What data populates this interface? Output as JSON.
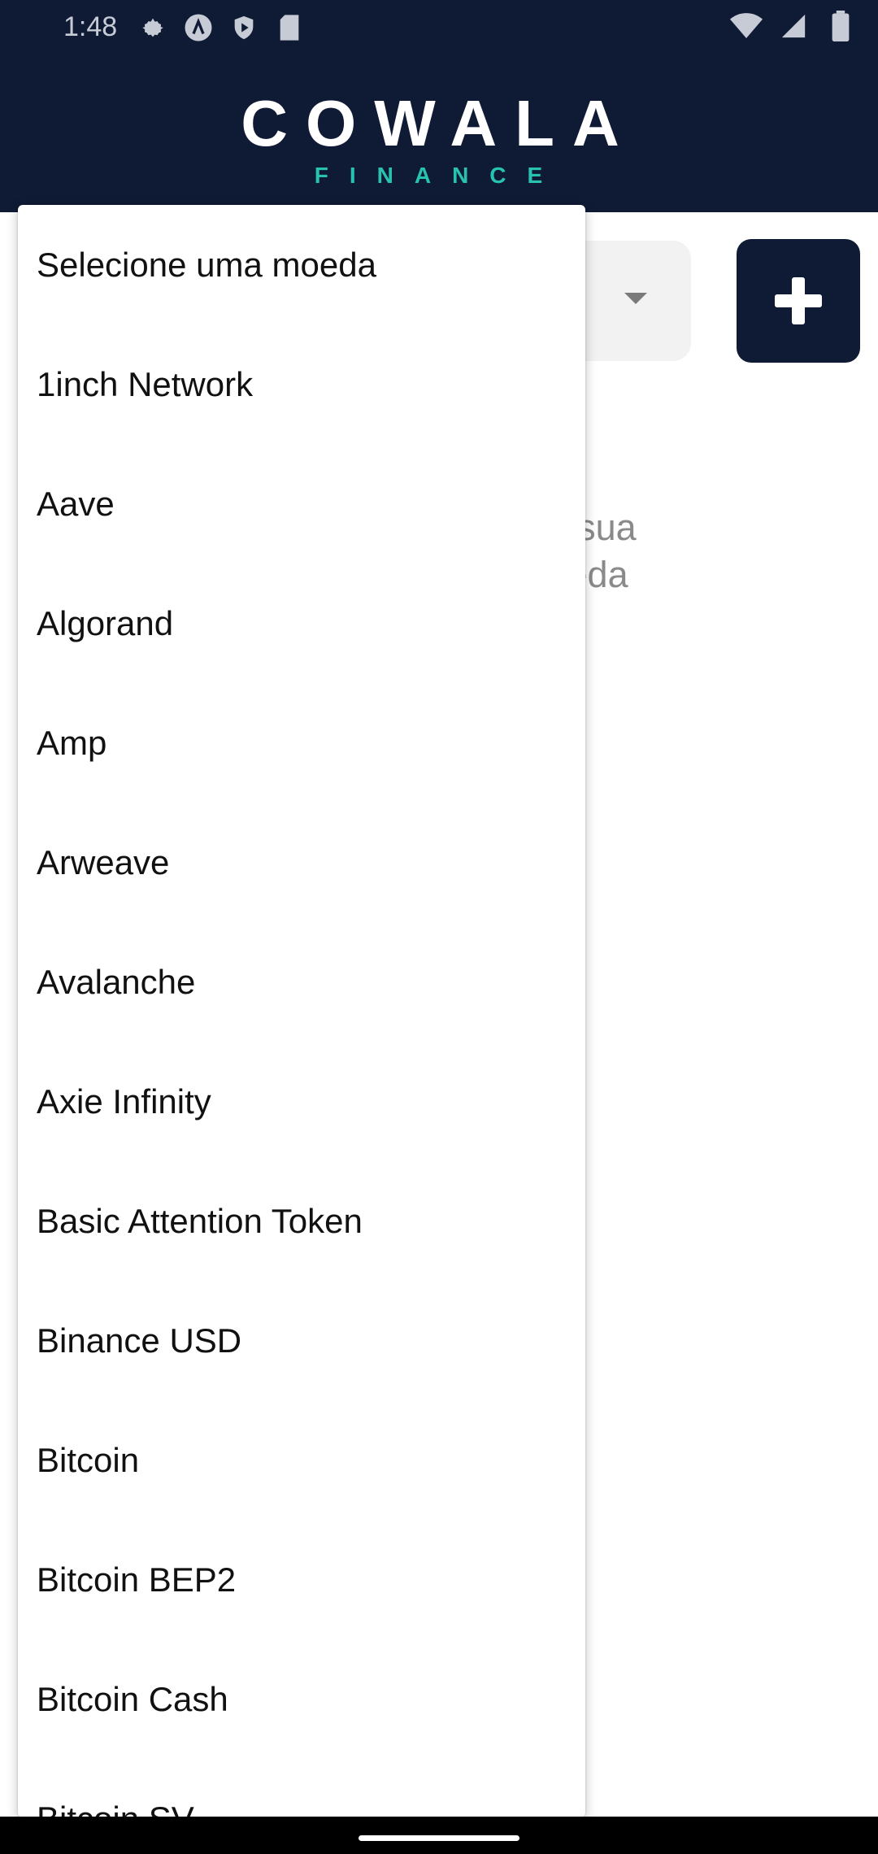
{
  "status_bar": {
    "time": "1:48"
  },
  "header": {
    "logo_main": "COWALA",
    "logo_sub": "FINANCE"
  },
  "main": {
    "select_value": "",
    "add_button_icon": "plus-icon",
    "empty_message": "eda na sua\nma moeda\nn +"
  },
  "dropdown": {
    "items": [
      "Selecione uma moeda",
      "1inch Network",
      "Aave",
      "Algorand",
      "Amp",
      "Arweave",
      "Avalanche",
      "Axie Infinity",
      "Basic Attention Token",
      "Binance USD",
      "Bitcoin",
      "Bitcoin BEP2",
      "Bitcoin Cash",
      "Bitcoin SV"
    ]
  },
  "colors": {
    "brand_navy": "#0f1a34",
    "brand_teal": "#27c2b0"
  }
}
